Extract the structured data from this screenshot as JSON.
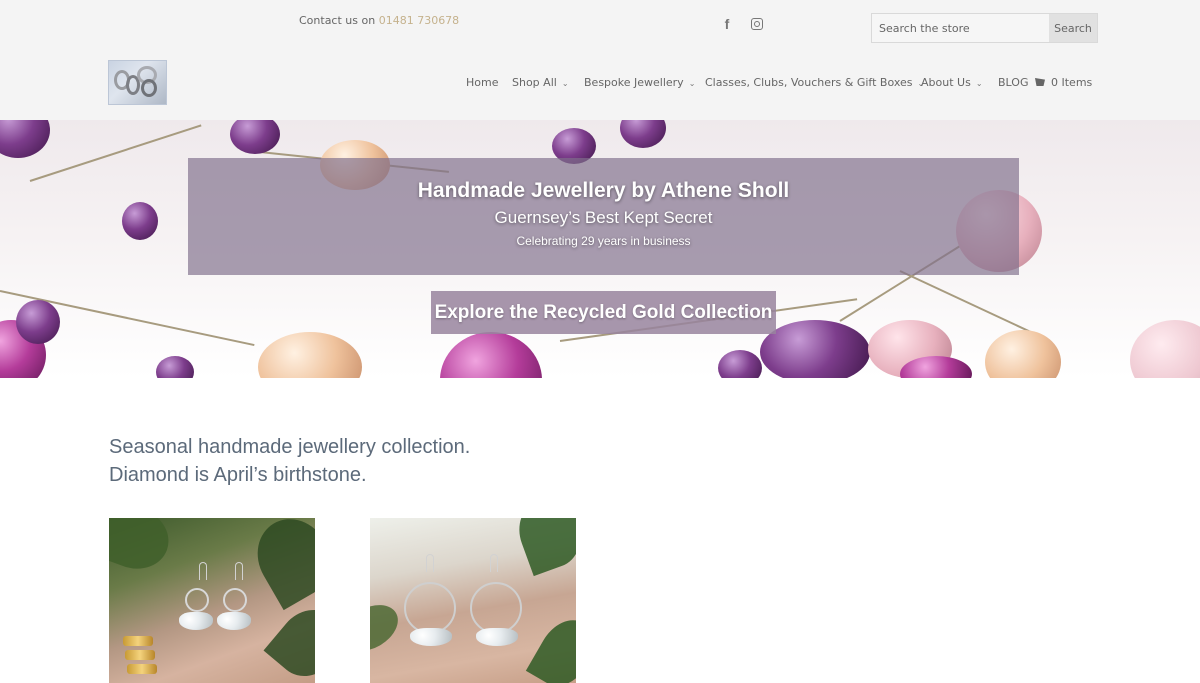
{
  "header": {
    "contact_prefix": "Contact us on ",
    "contact_phone": "01481 730678",
    "social": [
      {
        "name": "facebook-icon",
        "glyph": "f"
      },
      {
        "name": "instagram-icon",
        "glyph": ""
      }
    ],
    "search": {
      "placeholder": "Search the store",
      "button_label": "Search"
    }
  },
  "nav": {
    "items": [
      {
        "label": "Home",
        "has_dropdown": false
      },
      {
        "label": "Shop All",
        "has_dropdown": true
      },
      {
        "label": "Bespoke Jewellery",
        "has_dropdown": true
      },
      {
        "label": "Classes, Clubs, Vouchers & Gift Boxes",
        "has_dropdown": true
      },
      {
        "label": "About Us",
        "has_dropdown": true
      },
      {
        "label": "BLOG",
        "has_dropdown": false
      }
    ],
    "chevron_glyph": "⌄",
    "cart_label": "0 Items"
  },
  "hero": {
    "title": "Handmade Jewellery by Athene Sholl",
    "subtitle": "Guernsey’s Best Kept Secret",
    "tagline": "Celebrating 29 years in business",
    "cta_label": "Explore the Recycled Gold Collection"
  },
  "main": {
    "intro_line1": "Seasonal handmade jewellery collection.",
    "intro_line2": "Diamond is April’s birthstone."
  },
  "colors": {
    "accent_phone": "#c5b28d",
    "hero_panel": "#80708c",
    "intro_text": "#5c6a7a"
  }
}
